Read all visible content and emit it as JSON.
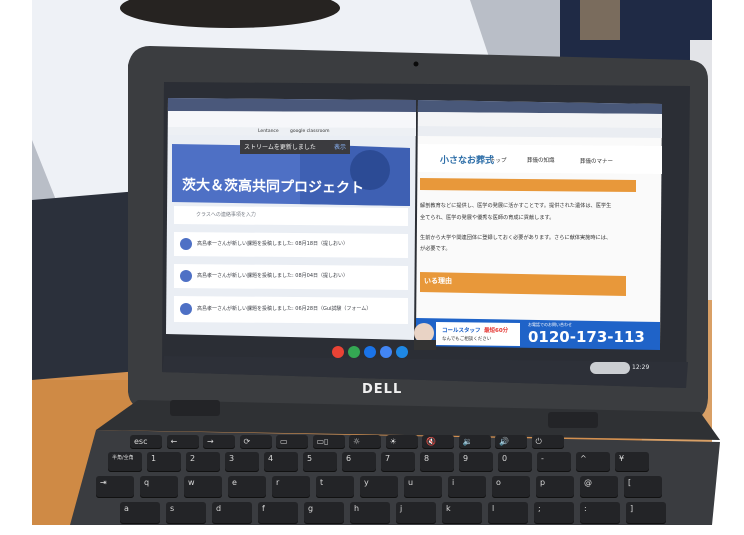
{
  "left_window": {
    "toast": "ストリームを更新しました",
    "toast_action": "表示",
    "class_title": "茨大＆茨高共同プロジェクト",
    "post_placeholder": "クラスへの連絡事項を入力",
    "stream_items": [
      "高島孝一さんが新しい課題を投稿しました: 08月18日（提しおい）",
      "高島孝一さんが新しい課題を投稿しました: 08月04日（提しおい）",
      "高島孝一さんが新しい課題を投稿しました: 06月28日（Gui試験（フォーム）"
    ]
  },
  "bookmarks": [
    "Lentance",
    "google classroom"
  ],
  "right_window": {
    "site_logo": "小さなお葬式",
    "nav": [
      "トップ",
      "葬儀の知識",
      "葬儀のマナー"
    ],
    "body_lines": [
      "解剖教育などに提供し、医学の発展に活かすことです。提供された遺体は、医学生",
      "全てられ、医学の発展や優秀な医師の育成に貢献します。",
      "生前から大学や関連団体に登録しておく必要があります。さらに献体実施時には、",
      "が必要です。"
    ],
    "section_heading": "いる理由",
    "ad_banner": {
      "line1": "コールスタッフ",
      "highlight": "最短60分",
      "line2": "なんでもご相談ください",
      "phone": "0120-173-113",
      "phone_caption": "お電話でのお問い合わせ"
    }
  },
  "shelf_time": "12:29",
  "brand": "DELL",
  "keyboard": {
    "row1": [
      "esc",
      "←",
      "→",
      "⟳",
      "▭",
      "▭▯",
      "☼",
      "☀",
      "🔇",
      "🔉",
      "🔊",
      "⏻"
    ],
    "row2": [
      "半角/全角",
      "1",
      "2",
      "3",
      "4",
      "5",
      "6",
      "7",
      "8",
      "9",
      "0",
      "-",
      "^",
      "¥"
    ],
    "row3": [
      "⇥",
      "q",
      "w",
      "e",
      "r",
      "t",
      "y",
      "u",
      "i",
      "o",
      "p",
      "@",
      "["
    ],
    "row4": [
      "a",
      "s",
      "d",
      "f",
      "g",
      "h",
      "j",
      "k",
      "l",
      ";",
      ":",
      "]"
    ]
  },
  "colors": {
    "lid": "#3b3d40",
    "screen_dark": "#1a1d24",
    "classroom_header": "#3f64c0",
    "site_orange": "#e7902a",
    "ad_blue": "#0c56c4",
    "table_wood": "#d58a3f"
  }
}
